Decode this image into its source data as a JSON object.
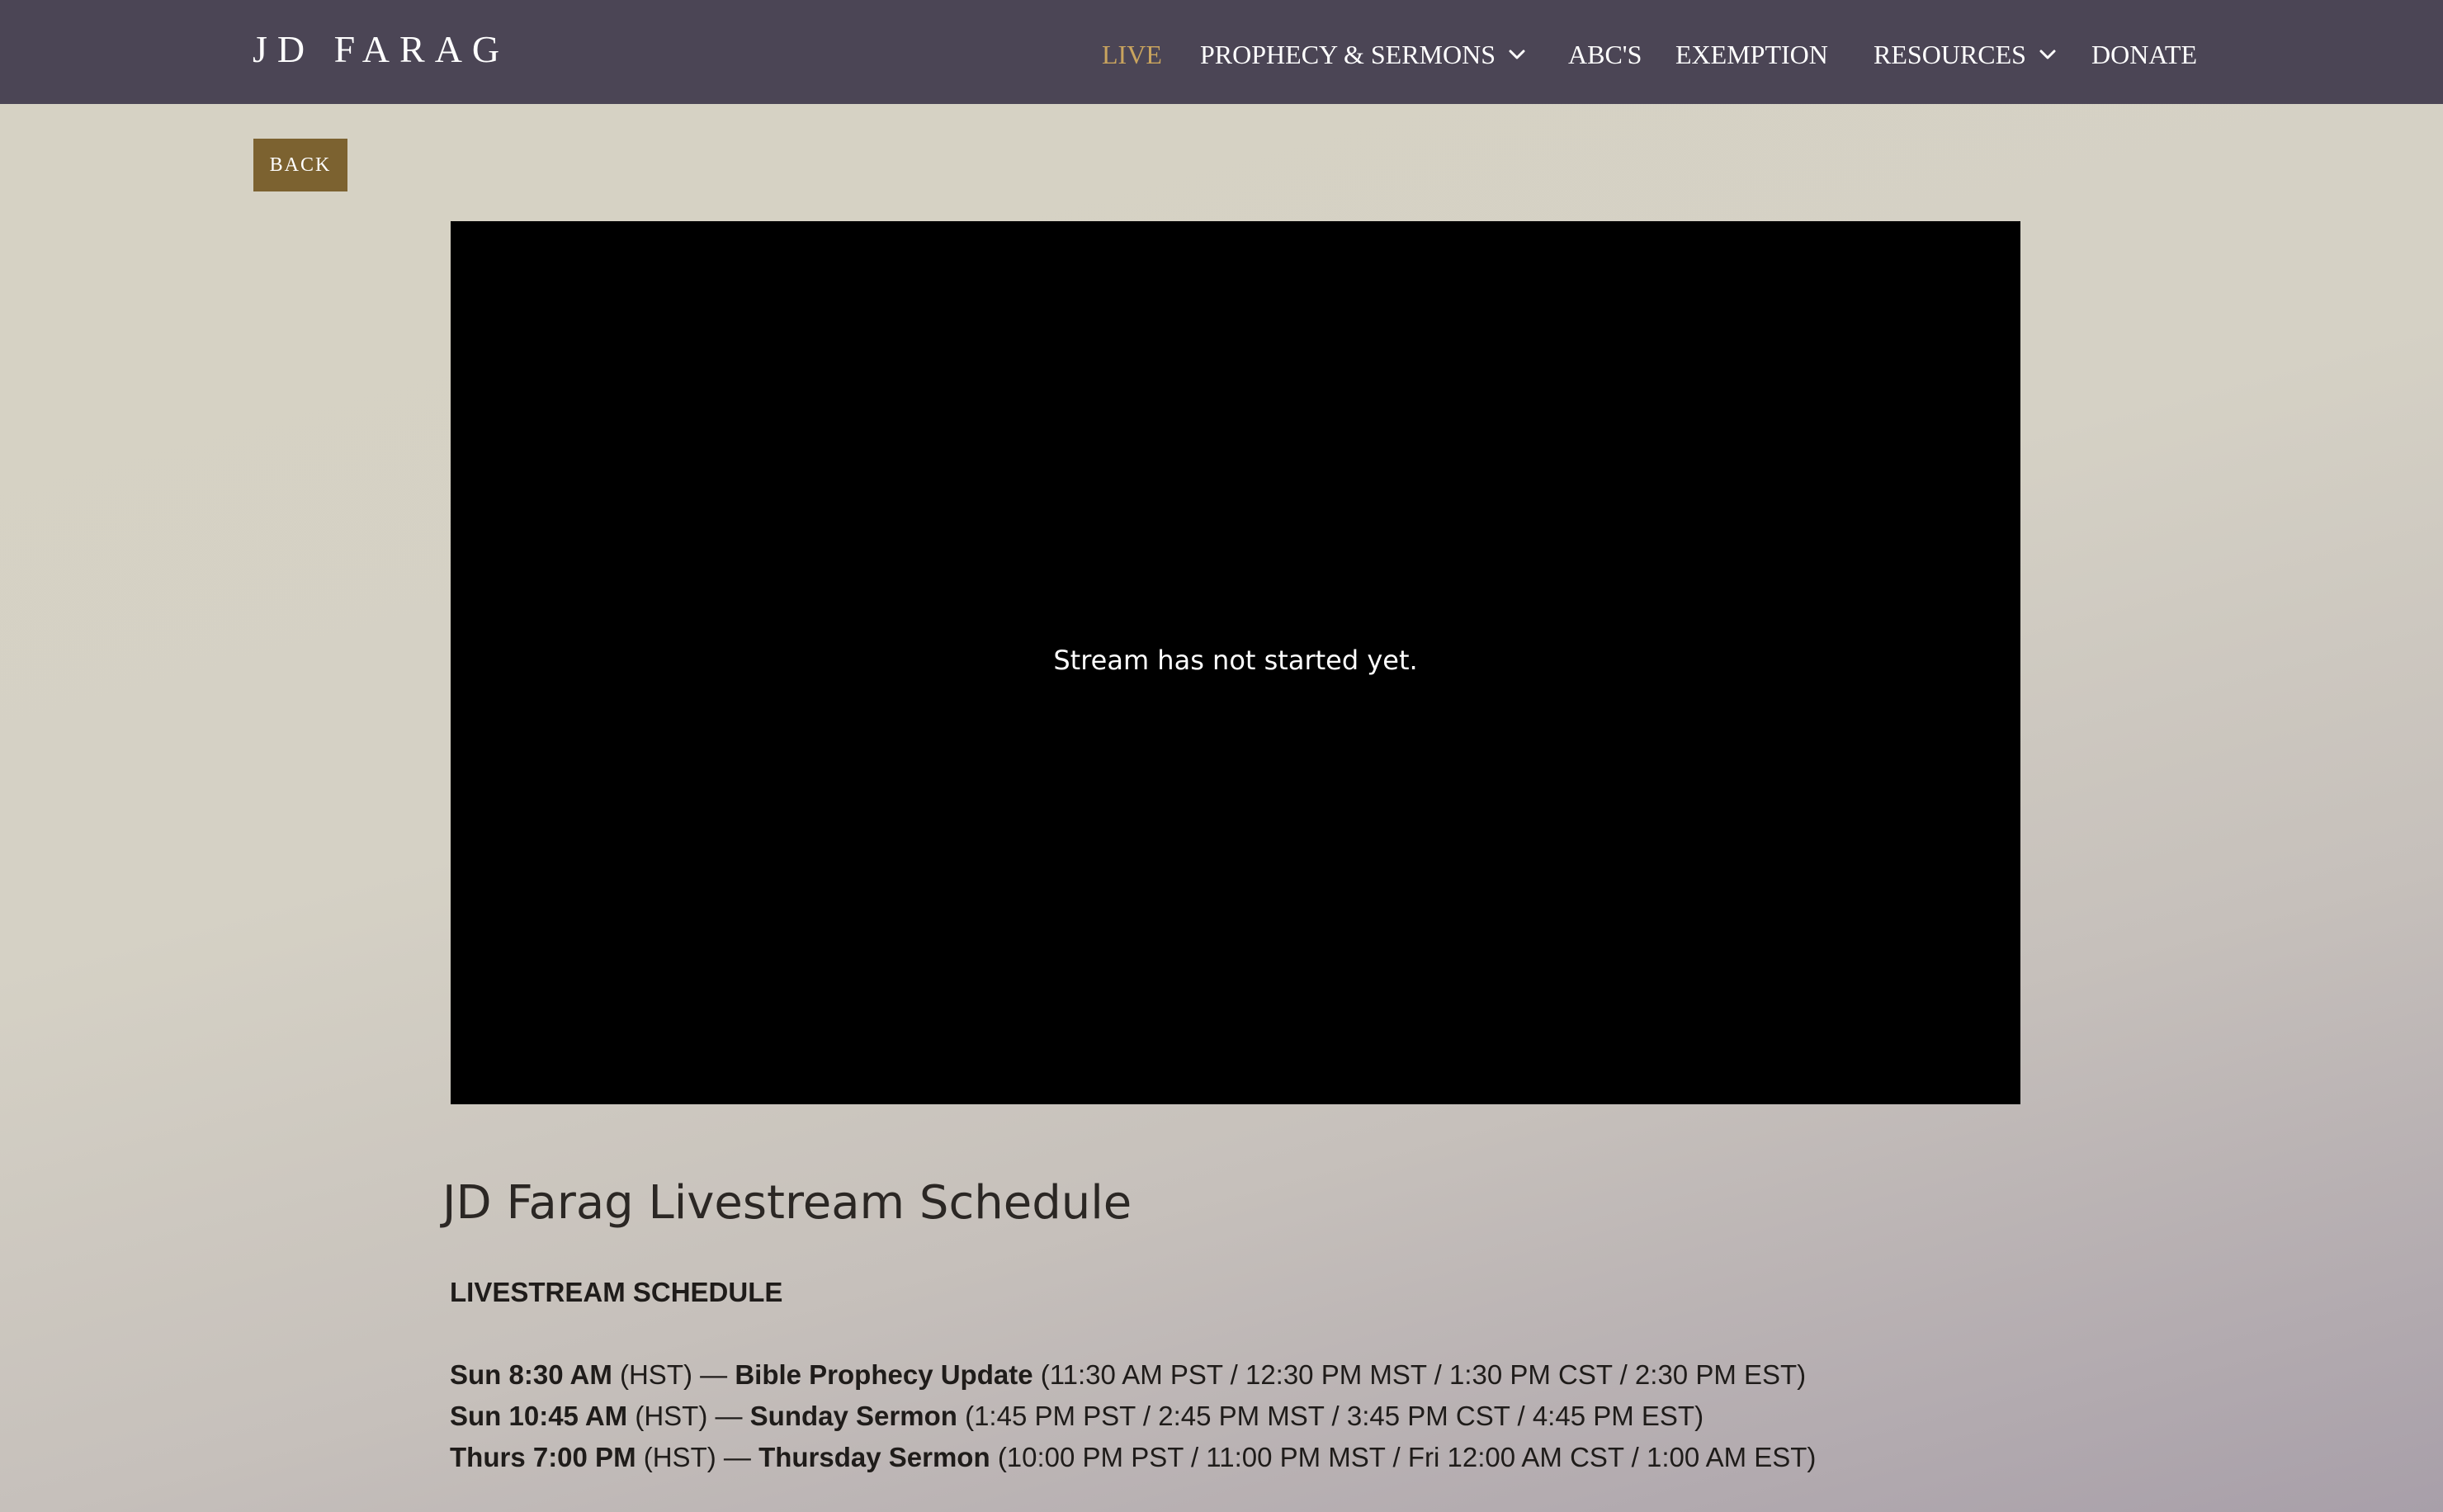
{
  "header": {
    "logo": "JD FARAG",
    "nav": [
      {
        "label": "LIVE",
        "active": true,
        "has_dropdown": false
      },
      {
        "label": "PROPHECY & SERMONS",
        "active": false,
        "has_dropdown": true
      },
      {
        "label": "ABC'S",
        "active": false,
        "has_dropdown": false
      },
      {
        "label": "EXEMPTION",
        "active": false,
        "has_dropdown": false
      },
      {
        "label": "RESOURCES",
        "active": false,
        "has_dropdown": true
      },
      {
        "label": "DONATE",
        "active": false,
        "has_dropdown": false
      }
    ]
  },
  "back_button": {
    "label": "BACK"
  },
  "video": {
    "status_message": "Stream has not started yet."
  },
  "content": {
    "title": "JD Farag Livestream Schedule",
    "heading": "LIVESTREAM SCHEDULE",
    "schedule": [
      {
        "time": "Sun 8:30 AM",
        "zone": "(HST) —",
        "event": "Bible Prophecy Update",
        "other_times": "(11:30 AM PST / 12:30 PM MST / 1:30 PM CST / 2:30 PM EST)"
      },
      {
        "time": "Sun 10:45 AM",
        "zone": "(HST) —",
        "event": "Sunday Sermon",
        "other_times": "(1:45 PM PST / 2:45 PM MST / 3:45 PM CST / 4:45 PM EST)"
      },
      {
        "time": "Thurs 7:00 PM",
        "zone": "(HST) —",
        "event": "Thursday Sermon",
        "other_times": "(10:00 PM PST / 11:00 PM MST / Fri 12:00 AM CST / 1:00 AM EST)"
      }
    ]
  },
  "colors": {
    "nav_background": "#4b4555",
    "nav_active": "#c9a45e",
    "back_button": "#7c6230",
    "page_background": "#d6d2c4"
  },
  "icons": {
    "dropdown": "chevron-down-icon"
  }
}
